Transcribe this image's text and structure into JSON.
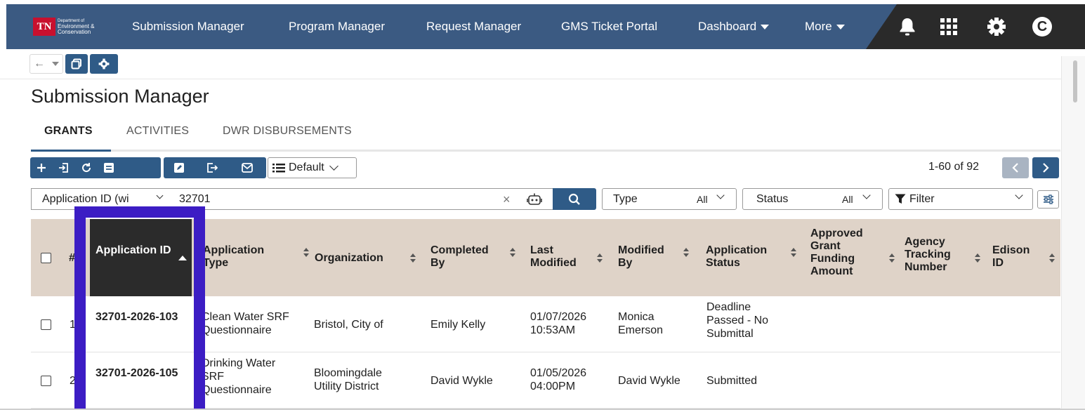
{
  "nav": {
    "logo_abbrev": "TN",
    "logo_line1": "Department of",
    "logo_line2": "Environment &",
    "logo_line3": "Conservation",
    "items": [
      "Submission Manager",
      "Program Manager",
      "Request Manager",
      "GMS Ticket Portal",
      "Dashboard",
      "More"
    ],
    "avatar_letter": "C"
  },
  "page": {
    "title": "Submission Manager"
  },
  "tabs": [
    "GRANTS",
    "ACTIVITIES",
    "DWR DISBURSEMENTS"
  ],
  "toolbar": {
    "view_select": "Default",
    "pager": "1-60 of 92"
  },
  "filters": {
    "search_field": "Application ID (wi",
    "search_value": "32701",
    "type_label": "Type",
    "type_value": "All",
    "status_label": "Status",
    "status_value": "All",
    "filter_label": "Filter"
  },
  "table": {
    "headers": {
      "num": "#",
      "application_id": "Application ID",
      "application_type": "Application Type",
      "organization": "Organization",
      "completed_by": "Completed By",
      "last_modified": "Last Modified",
      "modified_by": "Modified By",
      "application_status": "Application Status",
      "approved_amount": "Approved Grant Funding Amount",
      "agency_tracking": "Agency Tracking Number",
      "edison_id": "Edison ID"
    },
    "rows": [
      {
        "num": "1",
        "application_id": "32701-2026-103",
        "application_type": "Clean Water SRF Questionnaire",
        "organization": "Bristol, City of",
        "completed_by": "Emily Kelly",
        "last_modified": "01/07/2026 10:53AM",
        "modified_by": "Monica Emerson",
        "application_status": "Deadline Passed - No Submittal"
      },
      {
        "num": "2",
        "application_id": "32701-2026-105",
        "application_type": "Drinking Water SRF Questionnaire",
        "organization": "Bloomingdale Utility District",
        "completed_by": "David Wykle",
        "last_modified": "01/05/2026 04:00PM",
        "modified_by": "David Wykle",
        "application_status": "Submitted"
      }
    ]
  },
  "colors": {
    "nav_bg": "#3b5a82",
    "nav_dark": "#2a2a2a",
    "accent": "#2f5b87",
    "header_bg": "#dfd3c8",
    "highlight": "#3c1dc4",
    "logo_red": "#c8102e"
  }
}
